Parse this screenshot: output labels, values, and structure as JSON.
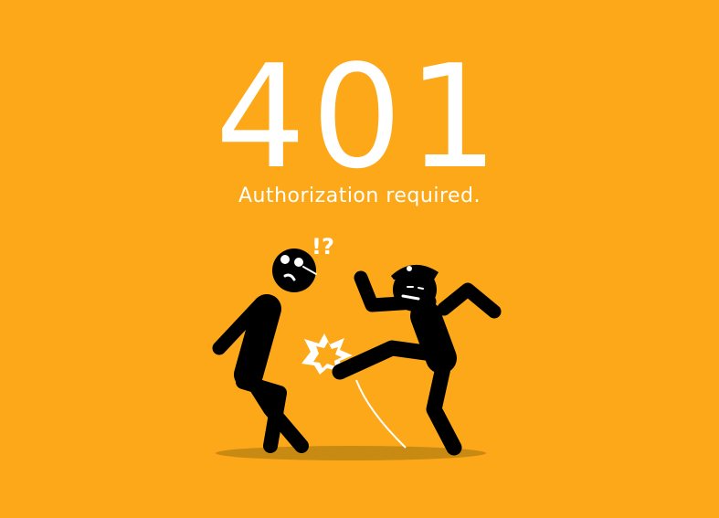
{
  "error": {
    "code": "401",
    "message": "Authorization required."
  },
  "illustration": {
    "confusion_mark": "!?",
    "icons": [
      "old-man-figure",
      "police-officer-figure",
      "kick-impact-burst"
    ]
  },
  "colors": {
    "background": "#FDA818",
    "text": "#FFFFFF",
    "figure": "#000000",
    "shadow": "#C98A14"
  }
}
